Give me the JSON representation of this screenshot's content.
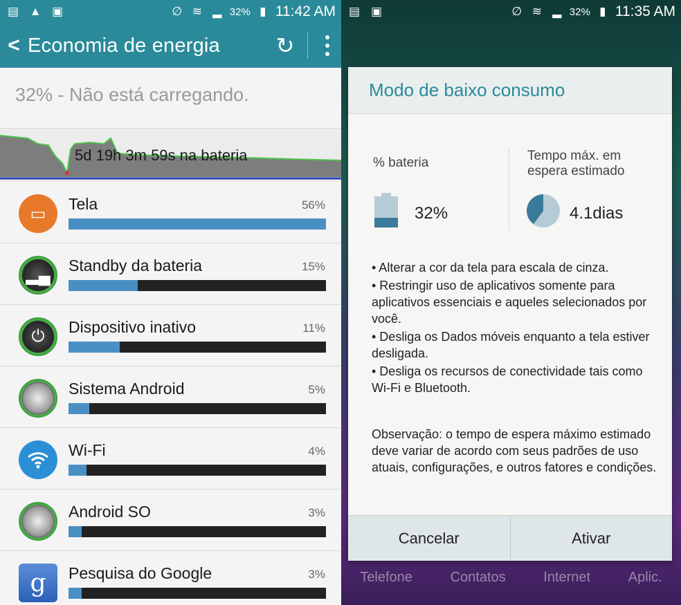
{
  "left": {
    "status": {
      "battery": "32%",
      "time": "11:42 AM"
    },
    "header": {
      "title": "Economia de energia"
    },
    "charge_status": "32% - Não está carregando.",
    "graph_label": "5d 19h 3m 59s na bateria",
    "usage": [
      {
        "name": "Tela",
        "percent": "56%",
        "fill": 1.0
      },
      {
        "name": "Standby da bateria",
        "percent": "15%",
        "fill": 0.27
      },
      {
        "name": "Dispositivo inativo",
        "percent": "11%",
        "fill": 0.2
      },
      {
        "name": "Sistema Android",
        "percent": "5%",
        "fill": 0.08
      },
      {
        "name": "Wi-Fi",
        "percent": "4%",
        "fill": 0.07
      },
      {
        "name": "Android SO",
        "percent": "3%",
        "fill": 0.05
      },
      {
        "name": "Pesquisa do Google",
        "percent": "3%",
        "fill": 0.05
      }
    ]
  },
  "right": {
    "status": {
      "battery": "32%",
      "time": "11:35 AM"
    },
    "dialog": {
      "title": "Modo de baixo consumo",
      "battery_label": "% bateria",
      "battery_value": "32%",
      "battery_level": 0.32,
      "standby_label_1": "Tempo máx. em",
      "standby_label_2": "espera estimado",
      "standby_value": "4.1dias",
      "bullets": [
        "• Alterar a cor da tela para escala de cinza.",
        "• Restringir uso de aplicativos somente para aplicativos essenciais e aqueles selecionados por você.",
        "• Desliga os Dados móveis enquanto a tela estiver desligada.",
        "• Desliga os recursos de conectividade tais como Wi-Fi e Bluetooth."
      ],
      "note": "Observação: o tempo de espera máximo estimado deve variar de acordo com seus padrões de uso atuais, configurações, e outros fatores e condições.",
      "cancel_label": "Cancelar",
      "activate_label": "Ativar"
    },
    "dock": [
      "Telefone",
      "Contatos",
      "Internet",
      "Aplic."
    ]
  },
  "colors": {
    "accent": "#2a8a9a",
    "usage_fill": "#4a8fc4",
    "battery_level": "#3a7a9a"
  }
}
